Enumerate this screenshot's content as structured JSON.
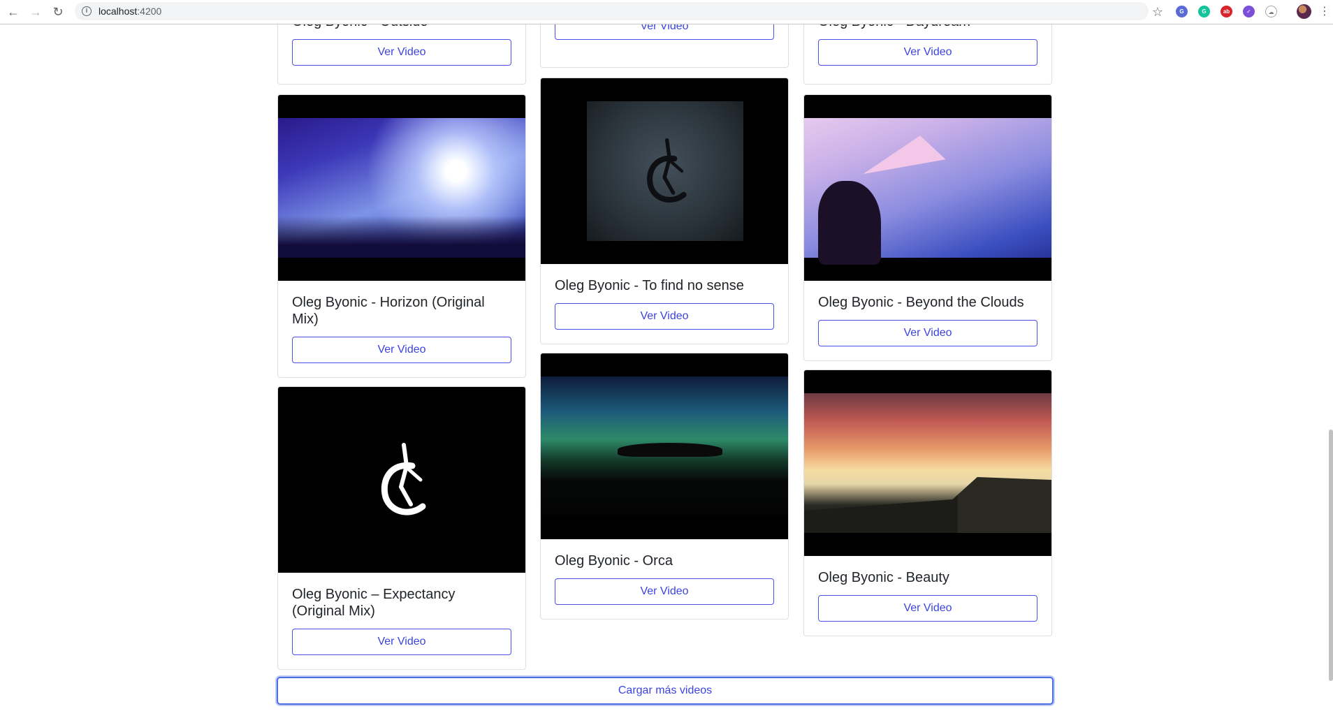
{
  "browser": {
    "url_host": "localhost",
    "url_port": ":4200"
  },
  "icons": {
    "back": "back-arrow-icon",
    "forward": "forward-arrow-icon",
    "reload": "reload-icon",
    "info": "info-icon",
    "bookmark": "star-icon"
  },
  "colors": {
    "accent": "#3b44e0",
    "border": "#dfdfdf",
    "page_bg": "#ffffff"
  },
  "top_row": [
    {
      "title": "Oleg Byonic - Outside",
      "button": "Ver Video"
    },
    {
      "title": "",
      "button": "Ver Video"
    },
    {
      "title": "Oleg Byonic - Daydream",
      "button": "Ver Video"
    }
  ],
  "videos": [
    {
      "title": "Oleg Byonic - Horizon (Original Mix)",
      "button": "Ver Video"
    },
    {
      "title": "Oleg Byonic - To find no sense",
      "button": "Ver Video"
    },
    {
      "title": "Oleg Byonic - Beyond the Clouds",
      "button": "Ver Video"
    },
    {
      "title": "Oleg Byonic – Expectancy (Original Mix)",
      "button": "Ver Video"
    },
    {
      "title": "Oleg Byonic - Orca",
      "button": "Ver Video"
    },
    {
      "title": "Oleg Byonic - Beauty",
      "button": "Ver Video"
    }
  ],
  "load_more": {
    "label": "Cargar más videos"
  }
}
